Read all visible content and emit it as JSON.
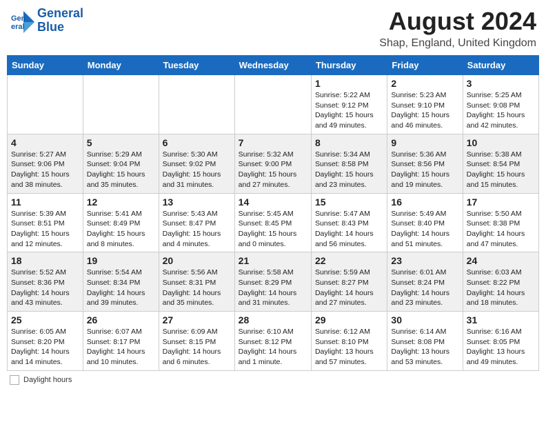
{
  "header": {
    "logo_line1": "General",
    "logo_line2": "Blue",
    "month": "August 2024",
    "location": "Shap, England, United Kingdom"
  },
  "days_of_week": [
    "Sunday",
    "Monday",
    "Tuesday",
    "Wednesday",
    "Thursday",
    "Friday",
    "Saturday"
  ],
  "weeks": [
    [
      {
        "num": "",
        "detail": ""
      },
      {
        "num": "",
        "detail": ""
      },
      {
        "num": "",
        "detail": ""
      },
      {
        "num": "",
        "detail": ""
      },
      {
        "num": "1",
        "detail": "Sunrise: 5:22 AM\nSunset: 9:12 PM\nDaylight: 15 hours\nand 49 minutes."
      },
      {
        "num": "2",
        "detail": "Sunrise: 5:23 AM\nSunset: 9:10 PM\nDaylight: 15 hours\nand 46 minutes."
      },
      {
        "num": "3",
        "detail": "Sunrise: 5:25 AM\nSunset: 9:08 PM\nDaylight: 15 hours\nand 42 minutes."
      }
    ],
    [
      {
        "num": "4",
        "detail": "Sunrise: 5:27 AM\nSunset: 9:06 PM\nDaylight: 15 hours\nand 38 minutes."
      },
      {
        "num": "5",
        "detail": "Sunrise: 5:29 AM\nSunset: 9:04 PM\nDaylight: 15 hours\nand 35 minutes."
      },
      {
        "num": "6",
        "detail": "Sunrise: 5:30 AM\nSunset: 9:02 PM\nDaylight: 15 hours\nand 31 minutes."
      },
      {
        "num": "7",
        "detail": "Sunrise: 5:32 AM\nSunset: 9:00 PM\nDaylight: 15 hours\nand 27 minutes."
      },
      {
        "num": "8",
        "detail": "Sunrise: 5:34 AM\nSunset: 8:58 PM\nDaylight: 15 hours\nand 23 minutes."
      },
      {
        "num": "9",
        "detail": "Sunrise: 5:36 AM\nSunset: 8:56 PM\nDaylight: 15 hours\nand 19 minutes."
      },
      {
        "num": "10",
        "detail": "Sunrise: 5:38 AM\nSunset: 8:54 PM\nDaylight: 15 hours\nand 15 minutes."
      }
    ],
    [
      {
        "num": "11",
        "detail": "Sunrise: 5:39 AM\nSunset: 8:51 PM\nDaylight: 15 hours\nand 12 minutes."
      },
      {
        "num": "12",
        "detail": "Sunrise: 5:41 AM\nSunset: 8:49 PM\nDaylight: 15 hours\nand 8 minutes."
      },
      {
        "num": "13",
        "detail": "Sunrise: 5:43 AM\nSunset: 8:47 PM\nDaylight: 15 hours\nand 4 minutes."
      },
      {
        "num": "14",
        "detail": "Sunrise: 5:45 AM\nSunset: 8:45 PM\nDaylight: 15 hours\nand 0 minutes."
      },
      {
        "num": "15",
        "detail": "Sunrise: 5:47 AM\nSunset: 8:43 PM\nDaylight: 14 hours\nand 56 minutes."
      },
      {
        "num": "16",
        "detail": "Sunrise: 5:49 AM\nSunset: 8:40 PM\nDaylight: 14 hours\nand 51 minutes."
      },
      {
        "num": "17",
        "detail": "Sunrise: 5:50 AM\nSunset: 8:38 PM\nDaylight: 14 hours\nand 47 minutes."
      }
    ],
    [
      {
        "num": "18",
        "detail": "Sunrise: 5:52 AM\nSunset: 8:36 PM\nDaylight: 14 hours\nand 43 minutes."
      },
      {
        "num": "19",
        "detail": "Sunrise: 5:54 AM\nSunset: 8:34 PM\nDaylight: 14 hours\nand 39 minutes."
      },
      {
        "num": "20",
        "detail": "Sunrise: 5:56 AM\nSunset: 8:31 PM\nDaylight: 14 hours\nand 35 minutes."
      },
      {
        "num": "21",
        "detail": "Sunrise: 5:58 AM\nSunset: 8:29 PM\nDaylight: 14 hours\nand 31 minutes."
      },
      {
        "num": "22",
        "detail": "Sunrise: 5:59 AM\nSunset: 8:27 PM\nDaylight: 14 hours\nand 27 minutes."
      },
      {
        "num": "23",
        "detail": "Sunrise: 6:01 AM\nSunset: 8:24 PM\nDaylight: 14 hours\nand 23 minutes."
      },
      {
        "num": "24",
        "detail": "Sunrise: 6:03 AM\nSunset: 8:22 PM\nDaylight: 14 hours\nand 18 minutes."
      }
    ],
    [
      {
        "num": "25",
        "detail": "Sunrise: 6:05 AM\nSunset: 8:20 PM\nDaylight: 14 hours\nand 14 minutes."
      },
      {
        "num": "26",
        "detail": "Sunrise: 6:07 AM\nSunset: 8:17 PM\nDaylight: 14 hours\nand 10 minutes."
      },
      {
        "num": "27",
        "detail": "Sunrise: 6:09 AM\nSunset: 8:15 PM\nDaylight: 14 hours\nand 6 minutes."
      },
      {
        "num": "28",
        "detail": "Sunrise: 6:10 AM\nSunset: 8:12 PM\nDaylight: 14 hours\nand 1 minute."
      },
      {
        "num": "29",
        "detail": "Sunrise: 6:12 AM\nSunset: 8:10 PM\nDaylight: 13 hours\nand 57 minutes."
      },
      {
        "num": "30",
        "detail": "Sunrise: 6:14 AM\nSunset: 8:08 PM\nDaylight: 13 hours\nand 53 minutes."
      },
      {
        "num": "31",
        "detail": "Sunrise: 6:16 AM\nSunset: 8:05 PM\nDaylight: 13 hours\nand 49 minutes."
      }
    ]
  ],
  "footer": {
    "daylight_label": "Daylight hours"
  }
}
